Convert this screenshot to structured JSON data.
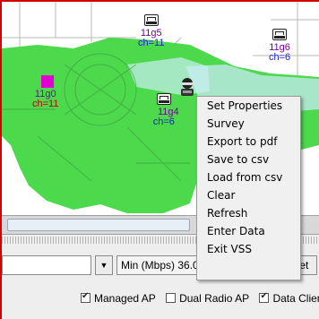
{
  "colors": {
    "coverage": "#4cd94c",
    "ap_label": "#7a00a0",
    "channel_label": "#1a1adc",
    "magenta_ap_label": "#c00000",
    "frame_border": "#d40000"
  },
  "map": {
    "access_points": [
      {
        "name": "11g5",
        "channel": "ch=11",
        "icon": "access-point-icon"
      },
      {
        "name": "11g6",
        "channel": "ch=6",
        "icon": "access-point-icon"
      },
      {
        "name": "11g0",
        "channel": "ch=11",
        "icon": "magenta-square-icon"
      },
      {
        "name": "11g4",
        "channel": "ch=6",
        "icon": "access-point-icon"
      }
    ],
    "client_icon": "data-client-icon"
  },
  "context_menu": {
    "items": [
      "Set Properties",
      "Survey",
      "Export to pdf",
      "Save to csv",
      "Load from csv",
      "Clear",
      "Refresh",
      "Enter Data",
      "Exit VSS"
    ]
  },
  "toolbar": {
    "dropdown_icon": "chevron-down-icon",
    "min_rate": "Min (Mbps) 36.0",
    "reset_label": "Reset"
  },
  "filters": [
    {
      "label": "Managed AP",
      "checked": true
    },
    {
      "label": "Dual Radio AP",
      "checked": false
    },
    {
      "label": "Data Client",
      "checked": true
    }
  ]
}
